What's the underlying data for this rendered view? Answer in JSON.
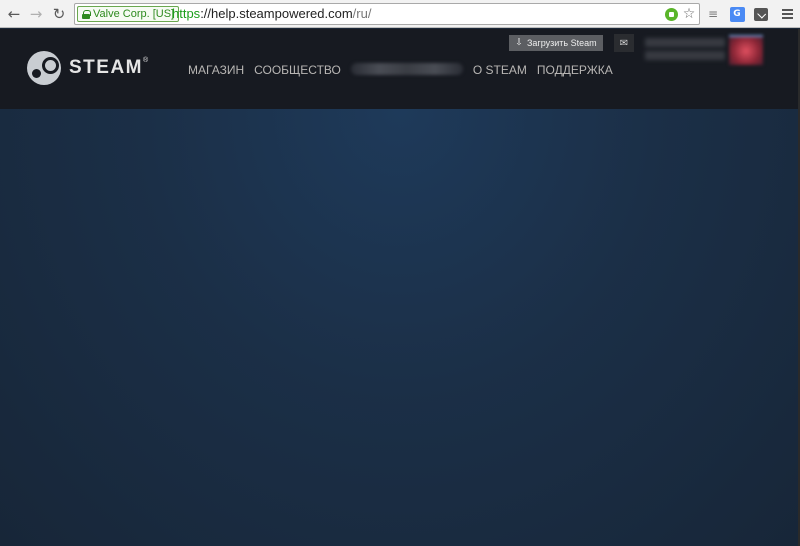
{
  "browser": {
    "ev_label": "Valve Corp. [US]",
    "url_scheme": "https",
    "url_host": "://help.steampowered.com",
    "url_path": "/ru/",
    "translate_icon_text": "G"
  },
  "header": {
    "logo_text": "STEAM",
    "trademark": "®",
    "install_label": "Загрузить Steam",
    "nav": {
      "store": "МАГАЗИН",
      "community": "СООБЩЕСТВО",
      "about": "О STEAM",
      "support": "ПОДДЕРЖКА"
    }
  },
  "colors": {
    "header_bg": "#171a21",
    "page_bg": "#1b2838",
    "nav_text": "#b8b6b4"
  },
  "icons": [
    "back-icon",
    "forward-icon",
    "reload-icon",
    "lock-icon",
    "star-icon",
    "rss-icon",
    "translate-icon",
    "pocket-icon",
    "menu-icon",
    "download-icon",
    "mail-icon",
    "steam-logo-icon"
  ]
}
